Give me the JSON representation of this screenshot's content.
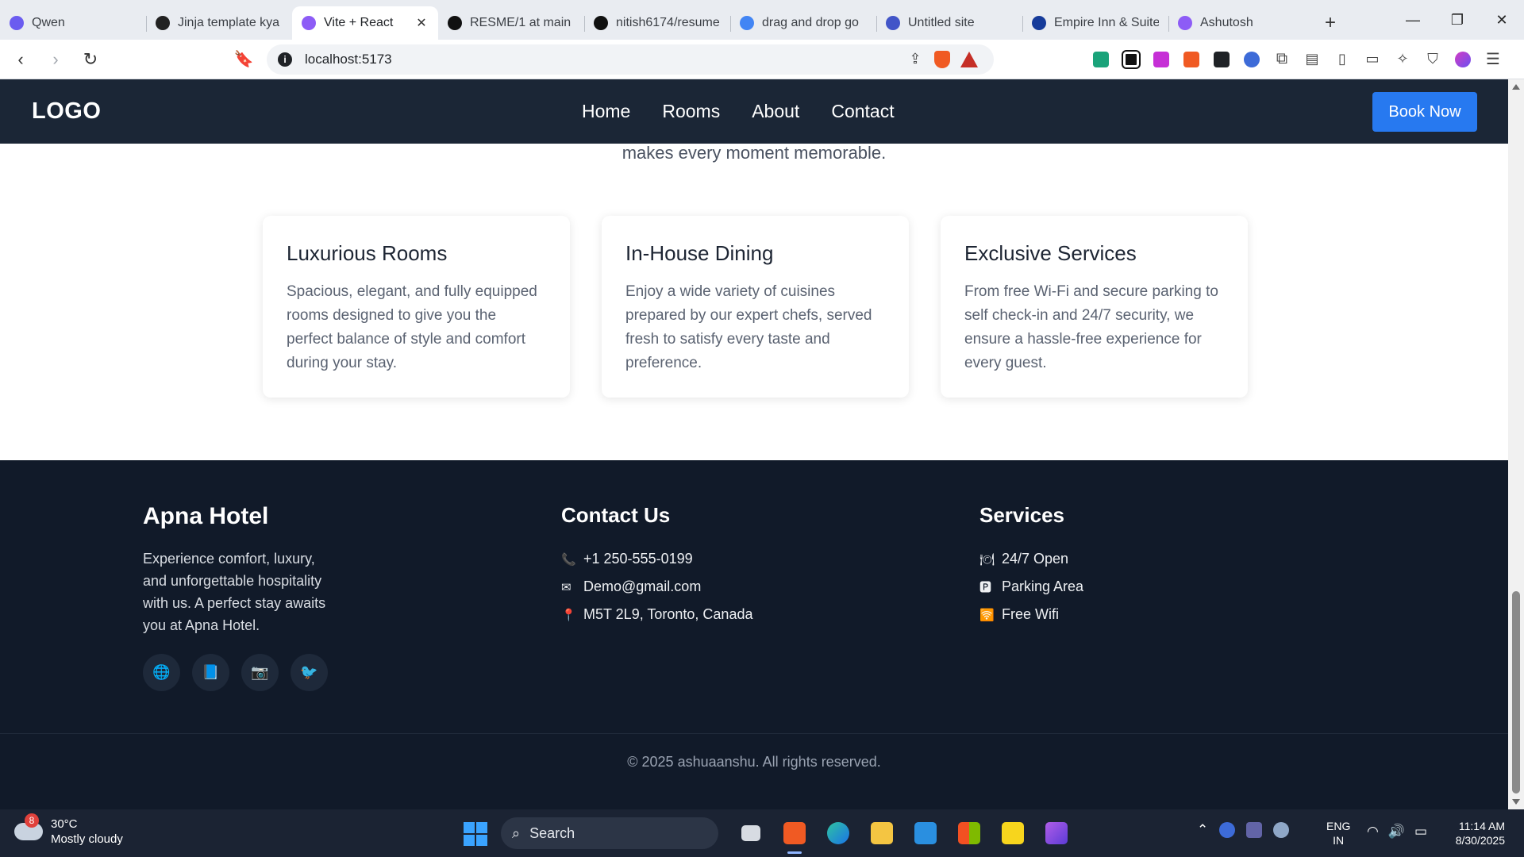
{
  "browser": {
    "tabs": [
      {
        "label": "Qwen",
        "icon": "qwen-icon",
        "color": "#6b5cf0"
      },
      {
        "label": "Jinja template kya",
        "icon": "openai-icon",
        "color": "#222222"
      },
      {
        "label": "Vite + React",
        "icon": "vite-icon",
        "color": "#8d5cf6",
        "active": true
      },
      {
        "label": "RESME/1 at main",
        "icon": "github-icon",
        "color": "#111111"
      },
      {
        "label": "nitish6174/resume",
        "icon": "github-icon",
        "color": "#111111"
      },
      {
        "label": "drag and drop go",
        "icon": "google-icon",
        "color": "#4285f4"
      },
      {
        "label": "Untitled site",
        "icon": "sites-icon",
        "color": "#4255c8"
      },
      {
        "label": "Empire Inn & Suite",
        "icon": "booking-icon",
        "color": "#163b9a"
      },
      {
        "label": "Ashutosh",
        "icon": "vite-icon",
        "color": "#8d5cf6"
      }
    ],
    "close_glyph": "✕",
    "new_tab_glyph": "+",
    "url": "localhost:5173",
    "window_controls": [
      "—",
      "❐",
      "✕"
    ]
  },
  "site": {
    "logo": "LOGO",
    "nav": [
      "Home",
      "Rooms",
      "About",
      "Contact"
    ],
    "cta": "Book Now",
    "intro_tail": "makes every moment memorable.",
    "features": [
      {
        "title": "Luxurious Rooms",
        "text": "Spacious, elegant, and fully equipped rooms designed to give you the perfect balance of style and comfort during your stay."
      },
      {
        "title": "In-House Dining",
        "text": "Enjoy a wide variety of cuisines prepared by our expert chefs, served fresh to satisfy every taste and preference."
      },
      {
        "title": "Exclusive Services",
        "text": "From free Wi-Fi and secure parking to self check-in and 24/7 security, we ensure a hassle-free experience for every guest."
      }
    ],
    "footer": {
      "brand": "Apna Hotel",
      "about": "Experience comfort, luxury, and unforgettable hospitality with us. A perfect stay awaits you at Apna Hotel.",
      "socials": [
        {
          "icon": "globe-icon",
          "glyph": "🌐"
        },
        {
          "icon": "book-icon",
          "glyph": "📘"
        },
        {
          "icon": "camera-icon",
          "glyph": "📷"
        },
        {
          "icon": "bird-icon",
          "glyph": "🐦"
        }
      ],
      "contact_title": "Contact Us",
      "contacts": [
        {
          "icon": "phone-icon",
          "glyph": "📞",
          "text": "+1 250-555-0199"
        },
        {
          "icon": "mail-icon",
          "glyph": "✉",
          "text": "Demo@gmail.com"
        },
        {
          "icon": "pin-icon",
          "glyph": "📍",
          "text": "M5T 2L9, Toronto, Canada"
        }
      ],
      "services_title": "Services",
      "services": [
        {
          "icon": "dining-icon",
          "glyph": "🍽",
          "text": "24/7 Open"
        },
        {
          "icon": "parking-icon",
          "glyph": "🅿",
          "text": "Parking Area"
        },
        {
          "icon": "wifi-icon",
          "glyph": "🛜",
          "text": "Free Wifi"
        }
      ],
      "copyright": "© 2025 ashuaanshu. All rights reserved."
    }
  },
  "taskbar": {
    "weather_badge": "8",
    "temperature": "30°C",
    "condition": "Mostly cloudy",
    "search": "Search",
    "lang_top": "ENG",
    "lang_bottom": "IN",
    "time": "11:14 AM",
    "date": "8/30/2025"
  },
  "colors": {
    "nav_bg": "#1b2636",
    "footer_bg": "#111a29",
    "accent": "#2779f0"
  }
}
